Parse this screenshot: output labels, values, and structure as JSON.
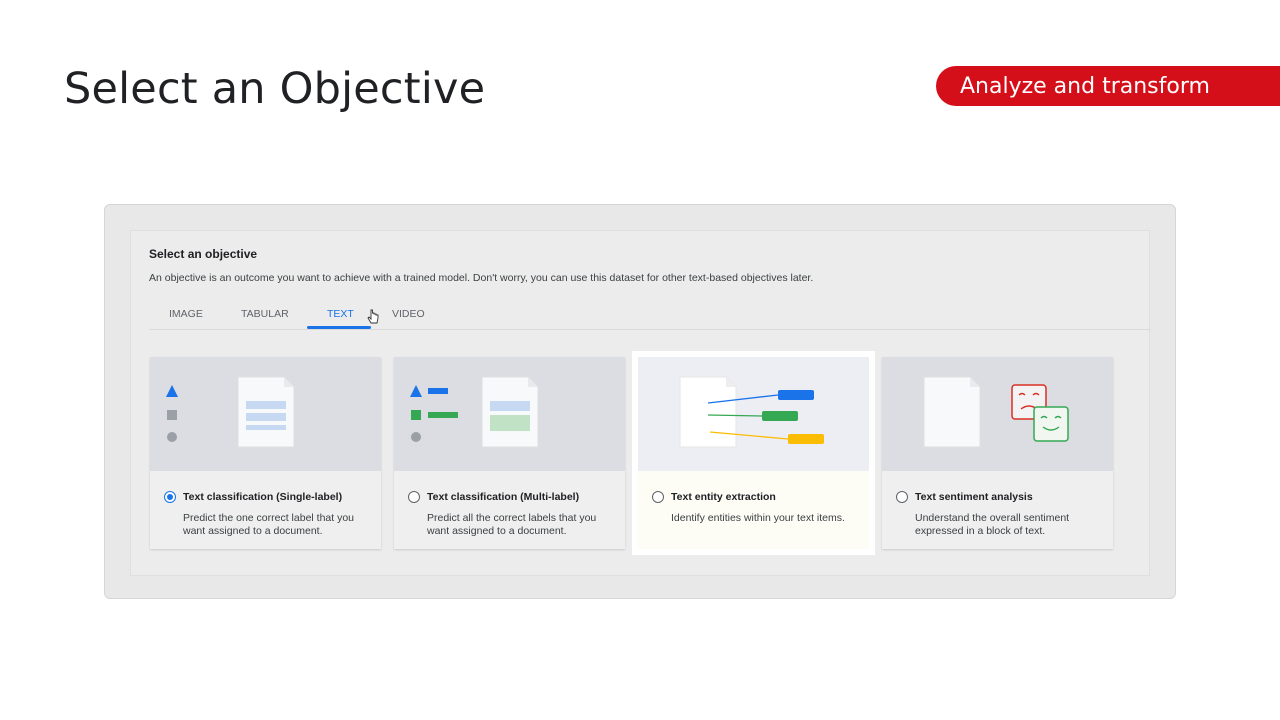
{
  "slide": {
    "title": "Select an Objective",
    "section_badge": "Analyze and transform"
  },
  "objective_panel": {
    "heading": "Select an objective",
    "description": "An objective is an outcome you want to achieve with a trained model. Don't worry, you can use this dataset for other text-based objectives later.",
    "tabs": [
      {
        "label": "IMAGE",
        "active": false
      },
      {
        "label": "TABULAR",
        "active": false
      },
      {
        "label": "TEXT",
        "active": true
      },
      {
        "label": "VIDEO",
        "active": false
      }
    ],
    "cards": [
      {
        "title": "Text classification (Single-label)",
        "description": "Predict the one correct label that you want assigned to a document.",
        "selected": true,
        "icon": "single-label-classification-illustration"
      },
      {
        "title": "Text classification (Multi-label)",
        "description": "Predict all the correct labels that you want assigned to a document.",
        "selected": false,
        "icon": "multi-label-classification-illustration"
      },
      {
        "title": "Text entity extraction",
        "description": "Identify entities within your text items.",
        "selected": false,
        "highlighted": true,
        "icon": "entity-extraction-illustration"
      },
      {
        "title": "Text sentiment analysis",
        "description": "Understand the overall sentiment expressed in a block of text.",
        "selected": false,
        "icon": "sentiment-faces-illustration"
      }
    ]
  },
  "colors": {
    "accent_blue": "#1a73e8",
    "badge_red": "#d50f1a",
    "green": "#34a853",
    "yellow": "#fbbc04",
    "red": "#ea4335"
  }
}
